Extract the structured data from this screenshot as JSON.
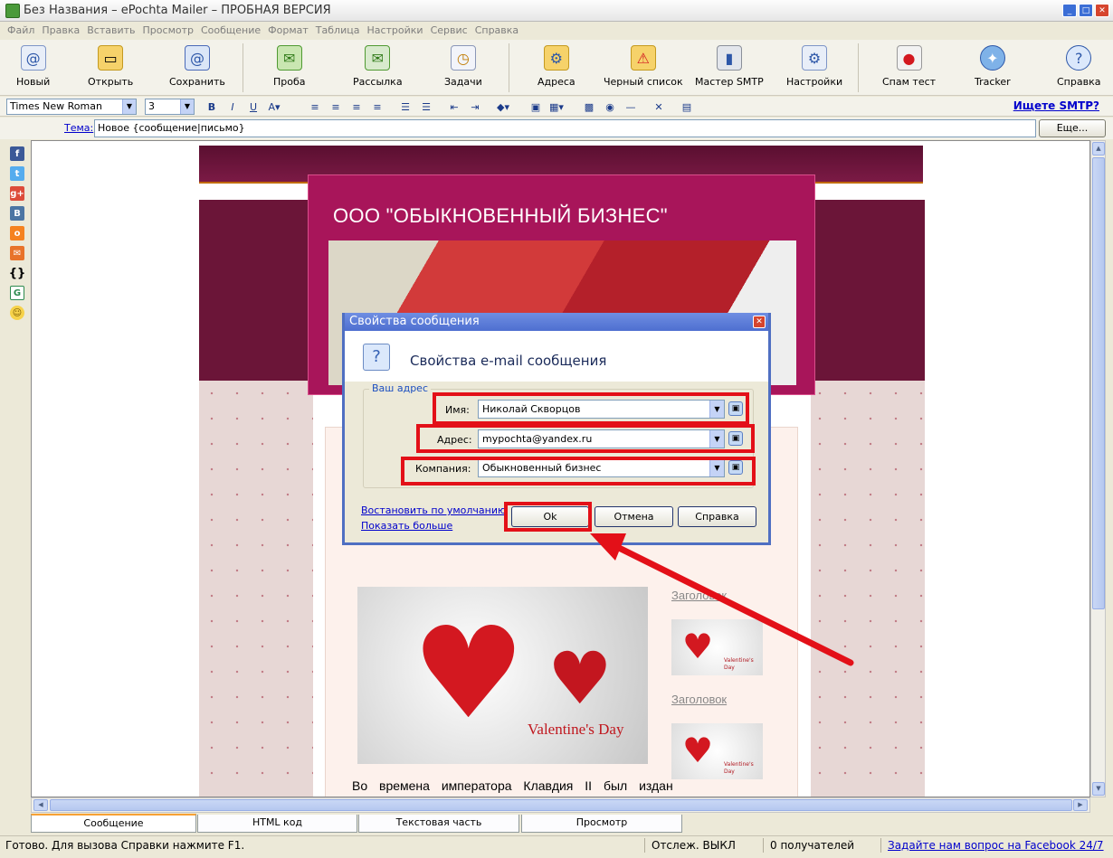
{
  "window": {
    "title": "Без Названия – ePochta Mailer – ПРОБНАЯ ВЕРСИЯ"
  },
  "menu": [
    "Файл",
    "Правка",
    "Вставить",
    "Просмотр",
    "Сообщение",
    "Формат",
    "Таблица",
    "Настройки",
    "Сервис",
    "Справка"
  ],
  "toolbar": {
    "new": "Новый",
    "open": "Открыть",
    "save": "Сохранить",
    "test": "Проба",
    "send": "Рассылка",
    "tasks": "Задачи",
    "addresses": "Адреса",
    "blacklist": "Черный список",
    "smtp_wizard": "Мастер SMTP",
    "settings": "Настройки",
    "spam_test": "Спам тест",
    "tracker": "Tracker",
    "help": "Справка"
  },
  "format": {
    "font": "Times New Roman",
    "size": "3",
    "smtp_link": "Ищете SMTP?"
  },
  "subject": {
    "label": "Тема:",
    "value": "Новое {сообщение|письмо}",
    "more": "Еще..."
  },
  "page": {
    "company": "ООО \"ОБЫКНОВЕННЫЙ БИЗНЕС\"",
    "vday": "Valentine's Day",
    "thumb_vday": "Valentine's Day",
    "heading1": "Заголовок",
    "heading2": "Заголовок",
    "body": "Во времена императора Клавдия II был издан"
  },
  "dialog": {
    "title": "Свойства сообщения",
    "heading": "Свойства e-mail сообщения",
    "group": "Ваш адрес",
    "name_label": "Имя:",
    "name_value": "Николай Скворцов",
    "addr_label": "Адрес:",
    "addr_value": "mypochta@yandex.ru",
    "company_label": "Компания:",
    "company_value": "Обыкновенный бизнес",
    "restore": "Востановить по умолчанию",
    "show_more": "Показать больше",
    "ok": "Ok",
    "cancel": "Отмена",
    "help": "Справка"
  },
  "tabs": [
    "Сообщение",
    "HTML код",
    "Текстовая часть",
    "Просмотр"
  ],
  "status": {
    "ready": "Готово. Для вызова Справки нажмите F1.",
    "tracking": "Отслеж. ВЫКЛ",
    "recipients": "0 получателей",
    "facebook": "Задайте нам вопрос на Facebook 24/7"
  },
  "colors": {
    "accent_red": "#e31018",
    "title_blue": "#4e6fd0"
  }
}
